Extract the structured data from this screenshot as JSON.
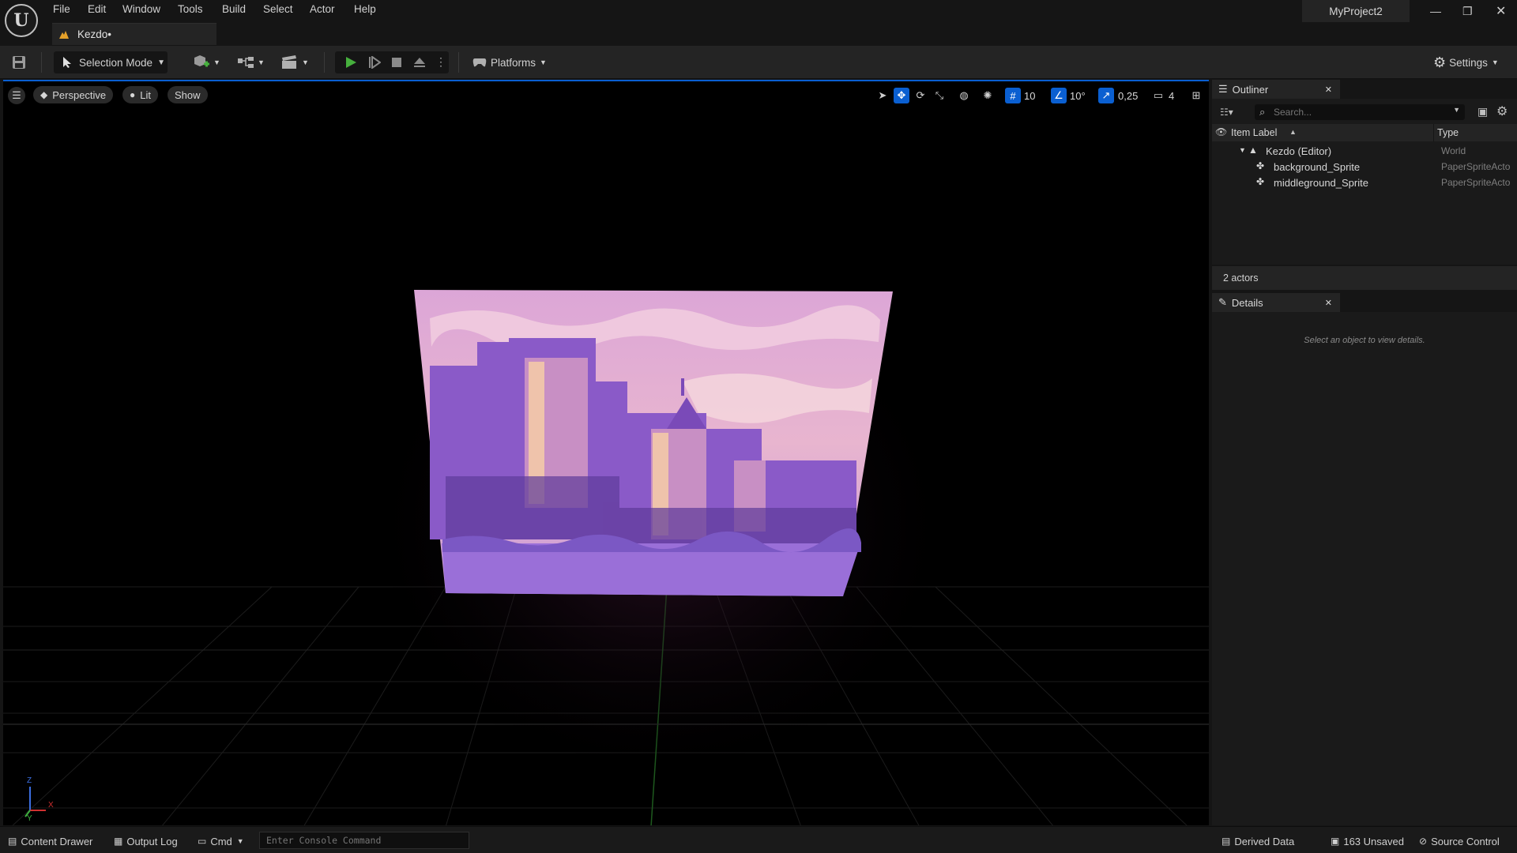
{
  "menu": {
    "items": [
      "File",
      "Edit",
      "Window",
      "Tools",
      "Build",
      "Select",
      "Actor",
      "Help"
    ]
  },
  "document_tab": {
    "label": "Kezdo•"
  },
  "project": {
    "name": "MyProject2"
  },
  "toolbar": {
    "selection_mode": "Selection Mode",
    "platforms": "Platforms",
    "settings": "Settings"
  },
  "viewport": {
    "perspective": "Perspective",
    "lit": "Lit",
    "show": "Show",
    "grid_snap": "10",
    "rotation_snap": "10°",
    "scale_snap": "0,25",
    "camera_speed": "4",
    "axis_x": "X",
    "axis_y": "Y",
    "axis_z": "Z"
  },
  "outliner": {
    "title": "Outliner",
    "search_placeholder": "Search...",
    "col_label": "Item Label",
    "col_type": "Type",
    "rows": [
      {
        "label": "Kezdo (Editor)",
        "type": "World"
      },
      {
        "label": "background_Sprite",
        "type": "PaperSpriteActo"
      },
      {
        "label": "middleground_Sprite",
        "type": "PaperSpriteActo"
      }
    ],
    "count": "2 actors"
  },
  "details": {
    "title": "Details",
    "empty_message": "Select an object to view details."
  },
  "statusbar": {
    "content_drawer": "Content Drawer",
    "output_log": "Output Log",
    "cmd": "Cmd",
    "console_placeholder": "Enter Console Command",
    "derived_data": "Derived Data",
    "unsaved": "163 Unsaved",
    "source_control": "Source Control"
  },
  "colors": {
    "accent": "#0a5fd1",
    "play_green": "#46b03d",
    "sky_top": "#d9a3d6",
    "sky_bottom": "#e7b6cf",
    "ground": "#9a6ed8"
  }
}
